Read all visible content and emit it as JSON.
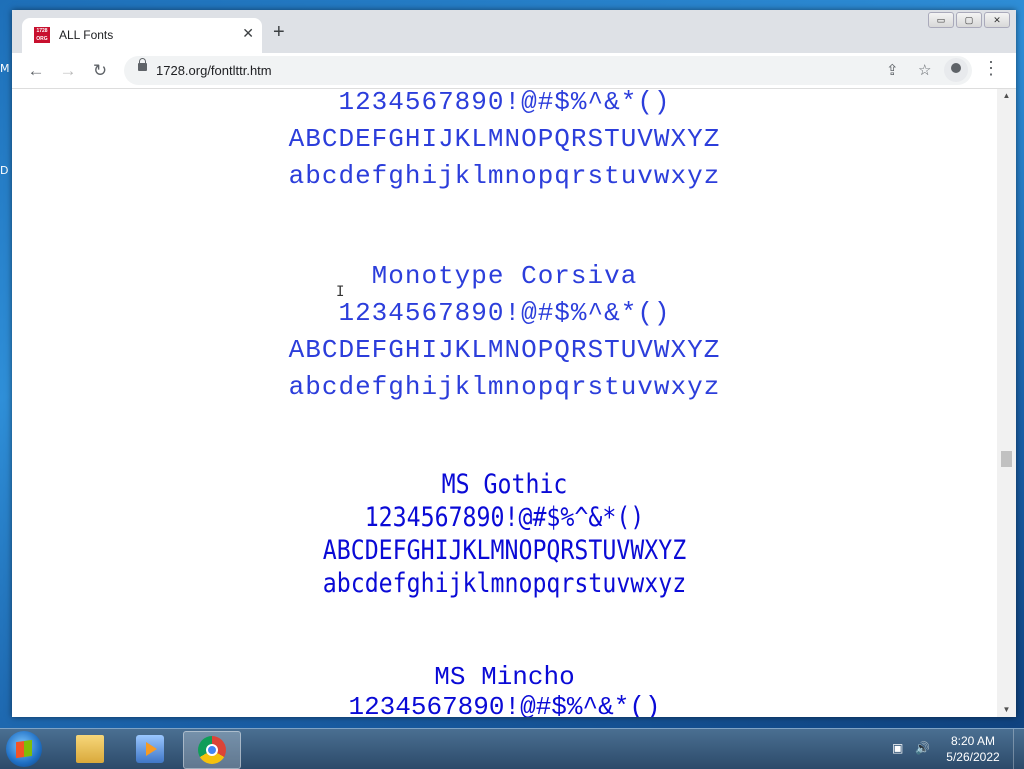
{
  "desktop": {
    "label_m": "M",
    "label_d": "D"
  },
  "browser": {
    "tab": {
      "title": "ALL Fonts",
      "favicon_text": "1728 ORG",
      "close": "✕"
    },
    "new_tab": "+",
    "window_controls": {
      "minimize": "▭",
      "maximize": "▢",
      "close": "✕"
    },
    "nav": {
      "back": "←",
      "forward": "→",
      "reload": "↻"
    },
    "url": "1728.org/fontlttr.htm",
    "menu": "⋮"
  },
  "page": {
    "sections": [
      {
        "font": "previous-monospace",
        "digits": "1234567890!@#$%^&*()",
        "upper": "ABCDEFGHIJKLMNOPQRSTUVWXYZ",
        "lower": "abcdefghijklmnopqrstuvwxyz"
      },
      {
        "font": "Monotype Corsiva",
        "title": "Monotype Corsiva",
        "digits": "1234567890!@#$%^&*()",
        "upper": "ABCDEFGHIJKLMNOPQRSTUVWXYZ",
        "lower": "abcdefghijklmnopqrstuvwxyz"
      },
      {
        "font": "MS Gothic",
        "title": "MS Gothic",
        "digits": "1234567890!@#$%^&*()",
        "upper": "ABCDEFGHIJKLMNOPQRSTUVWXYZ",
        "lower": "abcdefghijklmnopqrstuvwxyz"
      },
      {
        "font": "MS Mincho",
        "title": "MS Mincho",
        "digits": "1234567890!@#$%^&*()"
      }
    ],
    "text_color": "#1a1ae0"
  },
  "taskbar": {
    "apps": [
      "windows-explorer",
      "media-player",
      "google-chrome"
    ],
    "active_app": "google-chrome",
    "clock": {
      "time": "8:20 AM",
      "date": "5/26/2022"
    }
  }
}
